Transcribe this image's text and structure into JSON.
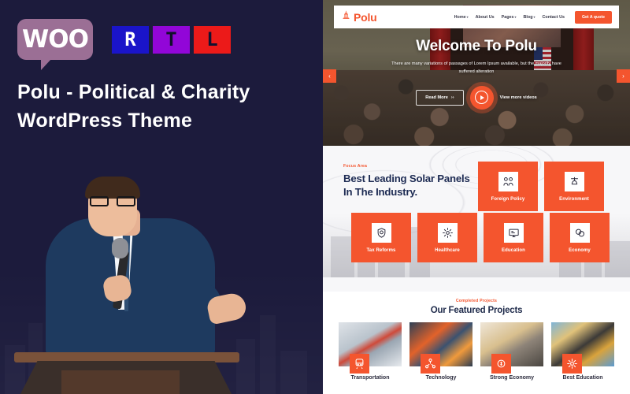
{
  "promo": {
    "badges": {
      "woo_label": "WOO",
      "rtl": [
        "R",
        "T",
        "L"
      ]
    },
    "title": "Polu - Political & Charity WordPress Theme",
    "colors": {
      "background": "#1c1b3c",
      "woo_badge": "#9b6f95",
      "rtl_blue": "#1a14c9",
      "rtl_purple": "#9206d8",
      "rtl_red": "#ec1a19",
      "accent": "#f4552e"
    }
  },
  "site": {
    "header": {
      "logo_text": "Polu",
      "logo_icon": "capitol-dome-icon",
      "nav": [
        {
          "label": "Home",
          "has_caret": true
        },
        {
          "label": "About Us",
          "has_caret": false
        },
        {
          "label": "Pages",
          "has_caret": true
        },
        {
          "label": "Blog",
          "has_caret": true
        },
        {
          "label": "Contact Us",
          "has_caret": false
        }
      ],
      "cta_label": "Get A quote"
    },
    "hero": {
      "title": "Welcome To Polu",
      "subtitle": "There are many variations of passages of Lorem Ipsum available, but the majority have suffered alteration",
      "primary_button": "Read More",
      "video_label": "View more videos",
      "prev_arrow": "‹",
      "next_arrow": "›"
    },
    "focus": {
      "eyebrow": "Focus Area",
      "title": "Best Leading Solar Panels In The Industry.",
      "cards_top": [
        {
          "label": "Foreign Policy",
          "icon": "handshake-policy-icon"
        },
        {
          "label": "Environment",
          "icon": "environment-leaf-icon"
        }
      ],
      "cards_bottom": [
        {
          "label": "Tax Reforms",
          "icon": "shield-tax-icon"
        },
        {
          "label": "Healthcare",
          "icon": "healthcare-cross-icon"
        },
        {
          "label": "Education",
          "icon": "education-board-icon"
        },
        {
          "label": "Economy",
          "icon": "economy-coins-icon"
        }
      ]
    },
    "projects": {
      "eyebrow": "Completed Projects",
      "title": "Our Featured Projects",
      "items": [
        {
          "label": "Transportation",
          "icon": "transport-icon"
        },
        {
          "label": "Technology",
          "icon": "technology-network-icon"
        },
        {
          "label": "Strong Economy",
          "icon": "economy-growth-icon"
        },
        {
          "label": "Best Education",
          "icon": "education-star-icon"
        }
      ]
    }
  }
}
